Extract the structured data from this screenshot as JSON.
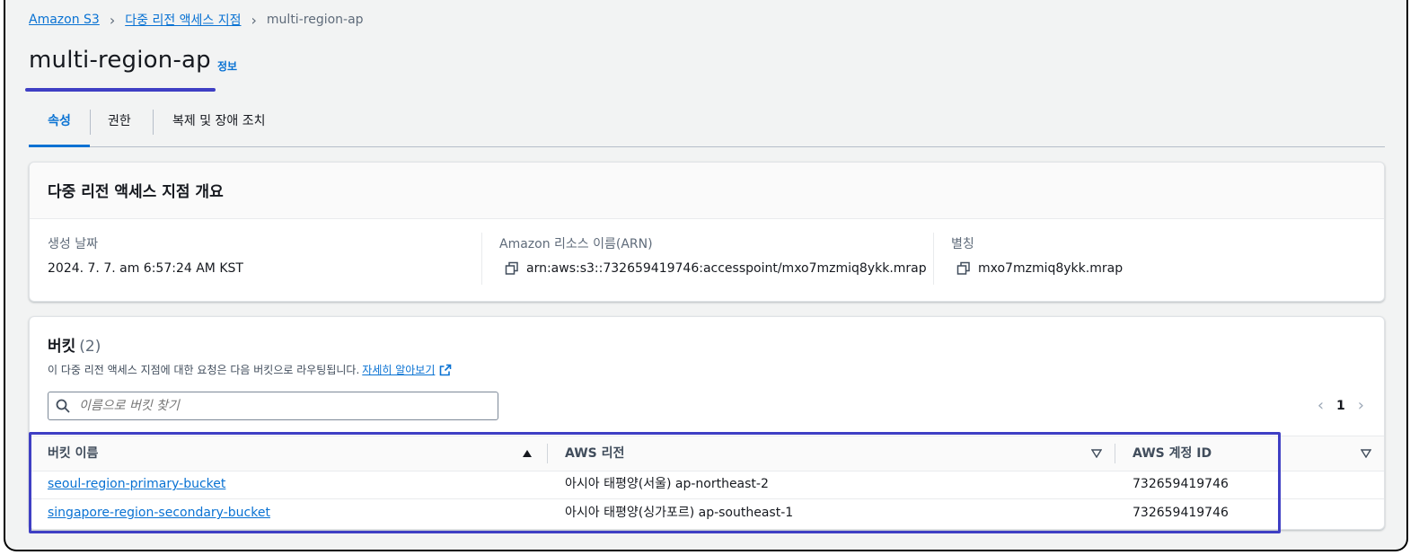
{
  "breadcrumb": [
    "Amazon S3",
    "다중 리전 액세스 지점",
    "multi-region-ap"
  ],
  "page": {
    "title": "multi-region-ap",
    "info": "정보"
  },
  "tabs": [
    "속성",
    "권한",
    "복제 및 장애 조치"
  ],
  "overview": {
    "heading": "다중 리전 액세스 지점 개요",
    "created_label": "생성 날짜",
    "created_value": "2024. 7. 7. am 6:57:24 AM KST",
    "arn_label": "Amazon 리소스 이름(ARN)",
    "arn_value": "arn:aws:s3::732659419746:accesspoint/mxo7mzmiq8ykk.mrap",
    "alias_label": "별칭",
    "alias_value": "mxo7mzmiq8ykk.mrap"
  },
  "buckets": {
    "heading": "버킷",
    "count": "(2)",
    "description": "이 다중 리전 액세스 지점에 대한 요청은 다음 버킷으로 라우팅됩니다.",
    "learn_more": "자세히 알아보기",
    "search_placeholder": "이름으로 버킷 찾기",
    "page": "1",
    "columns": [
      "버킷 이름",
      "AWS 리전",
      "AWS 계정 ID"
    ],
    "rows": [
      {
        "name": "seoul-region-primary-bucket",
        "region": "아시아 태평양(서울) ap-northeast-2",
        "account": "732659419746"
      },
      {
        "name": "singapore-region-secondary-bucket",
        "region": "아시아 태평양(싱가포르) ap-southeast-1",
        "account": "732659419746"
      }
    ]
  },
  "colors": {
    "link": "#0972d3",
    "highlight": "#3f3fc4"
  }
}
